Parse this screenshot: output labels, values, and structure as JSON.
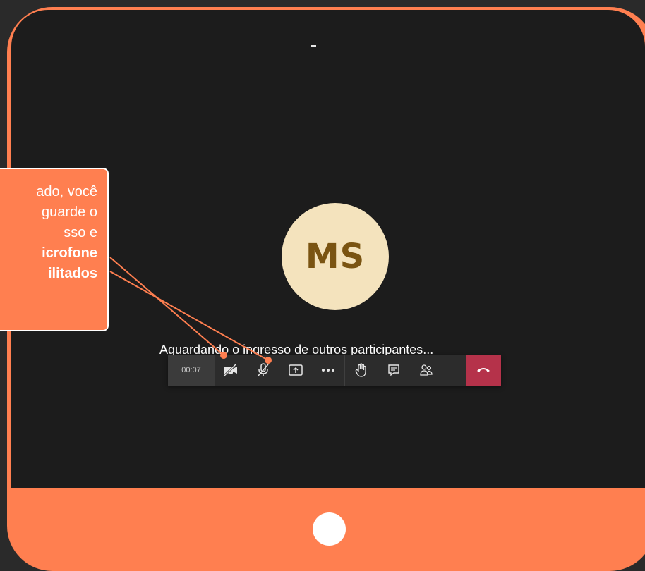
{
  "meeting": {
    "top_marker": "-",
    "avatar_initials": "MS",
    "waiting_text": "Aguardando o ingresso de outros participantes...",
    "timer": "00:07"
  },
  "toolbar": {
    "buttons": [
      {
        "name": "camera-off-icon"
      },
      {
        "name": "mic-off-icon"
      },
      {
        "name": "share-screen-icon"
      },
      {
        "name": "more-options-icon"
      },
      {
        "name": "raise-hand-icon"
      },
      {
        "name": "chat-icon"
      },
      {
        "name": "participants-icon"
      },
      {
        "name": "hang-up-icon"
      }
    ]
  },
  "callout": {
    "lines": [
      "ado, você",
      "guarde o",
      "sso e",
      "icrofone",
      "ilitados"
    ]
  },
  "colors": {
    "accent": "#ff7f50",
    "screen": "#1c1c1c",
    "hangup": "#b5324a",
    "avatar_bg": "#f4e3bd",
    "avatar_text": "#7a5412"
  }
}
